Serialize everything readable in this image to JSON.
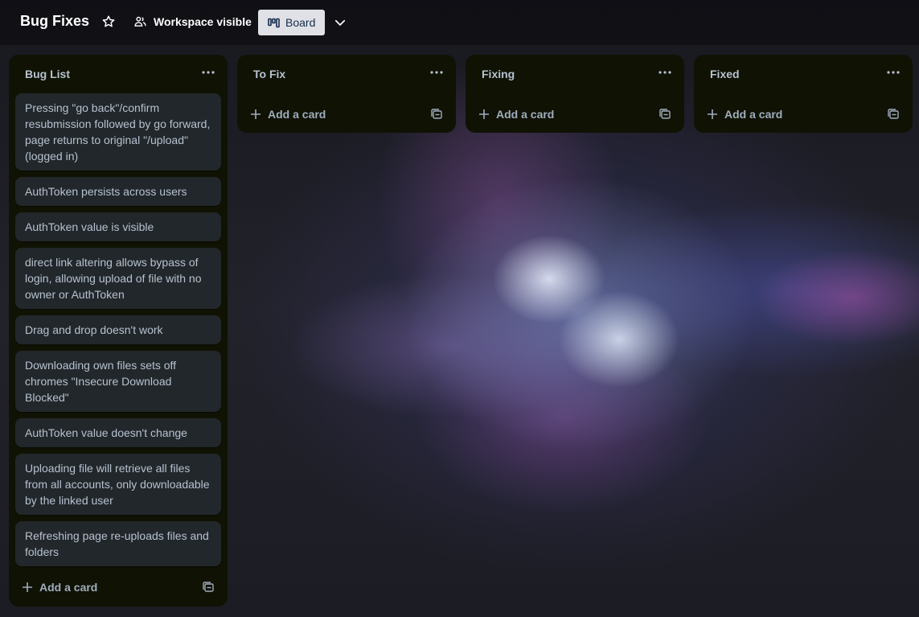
{
  "header": {
    "board_title": "Bug Fixes",
    "visibility_label": "Workspace visible",
    "view_label": "Board"
  },
  "lists": [
    {
      "title": "Bug List",
      "cards": [
        "Pressing \"go back\"/confirm resubmission followed by go forward, page returns to original \"/upload\" (logged in)",
        "AuthToken persists across users",
        "AuthToken value is visible",
        "direct link altering allows bypass of login, allowing upload of file with no owner or AuthToken",
        "Drag and drop doesn't work",
        "Downloading own files sets off chromes \"Insecure Download Blocked\"",
        "AuthToken value doesn't change",
        "Uploading file will retrieve all files from all accounts, only downloadable by the linked user",
        "Refreshing page re-uploads files and folders"
      ],
      "add_card_label": "Add a card"
    },
    {
      "title": "To Fix",
      "cards": [],
      "add_card_label": "Add a card"
    },
    {
      "title": "Fixing",
      "cards": [],
      "add_card_label": "Add a card"
    },
    {
      "title": "Fixed",
      "cards": [],
      "add_card_label": "Add a card"
    }
  ],
  "icons": {
    "star": "star-icon",
    "visibility": "workspace-icon",
    "board_view": "board-view-icon",
    "views_dropdown": "chevron-down-icon",
    "list_menu": "more-icon",
    "add": "plus-icon",
    "template": "card-template-icon"
  },
  "colors": {
    "list_bg": "#101204",
    "card_bg": "#22272b",
    "text": "#b6c2cf",
    "view_button_bg": "#dfe1e6"
  }
}
